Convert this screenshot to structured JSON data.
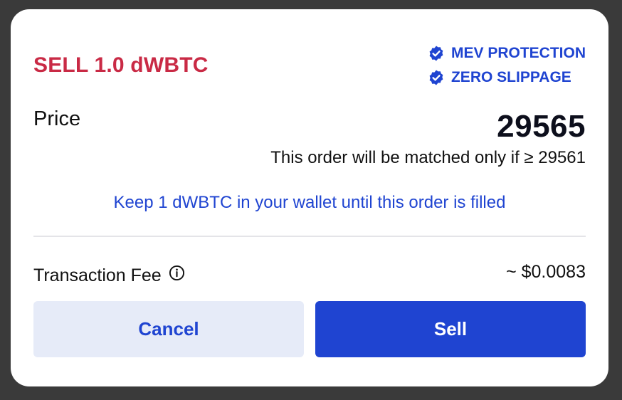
{
  "dialog": {
    "title": "SELL 1.0 dWBTC",
    "title_color": "#c92a45",
    "accent_color": "#1f44d1"
  },
  "badges": [
    {
      "label": "MEV PROTECTION",
      "icon": "verified-check-icon"
    },
    {
      "label": "ZERO SLIPPAGE",
      "icon": "verified-check-icon"
    }
  ],
  "price": {
    "label": "Price",
    "value": "29565",
    "match_note": "This order will be matched only if ≥ 29561"
  },
  "notice": "Keep 1 dWBTC in your wallet until this order is filled",
  "fee": {
    "label": "Transaction Fee",
    "info_icon": "info-circle-icon",
    "value": "~ $0.0083"
  },
  "actions": {
    "cancel_label": "Cancel",
    "sell_label": "Sell"
  }
}
